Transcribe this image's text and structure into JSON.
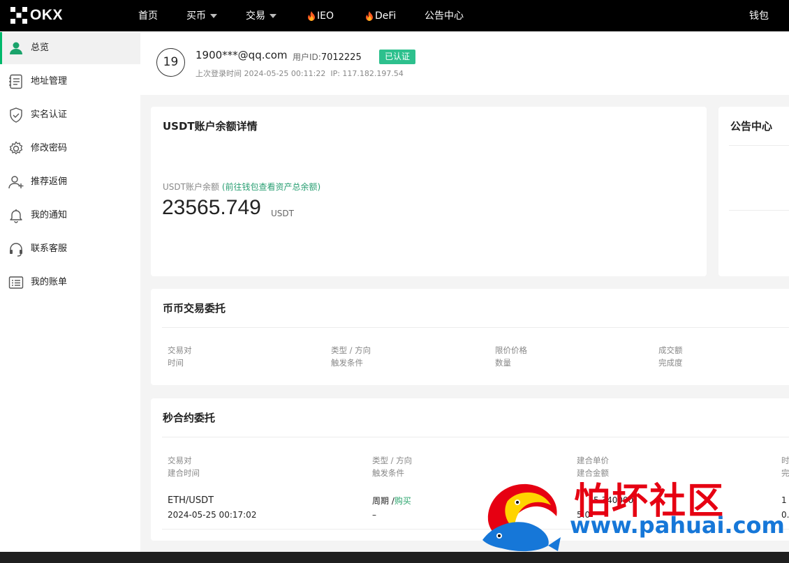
{
  "topbar": {
    "brand": "OKX",
    "nav": [
      {
        "label": "首页"
      },
      {
        "label": "买币"
      },
      {
        "label": "交易"
      },
      {
        "label": "IEO"
      },
      {
        "label": "DeFi"
      },
      {
        "label": "公告中心"
      }
    ],
    "wallet": "钱包"
  },
  "sidebar": {
    "items": [
      {
        "label": "总览",
        "icon": "user-icon"
      },
      {
        "label": "地址管理",
        "icon": "address-list-icon"
      },
      {
        "label": "实名认证",
        "icon": "shield-check-icon"
      },
      {
        "label": "修改密码",
        "icon": "gear-icon"
      },
      {
        "label": "推荐返佣",
        "icon": "user-add-icon"
      },
      {
        "label": "我的通知",
        "icon": "bell-icon"
      },
      {
        "label": "联系客服",
        "icon": "headset-icon"
      },
      {
        "label": "我的账单",
        "icon": "list-icon"
      }
    ]
  },
  "profile": {
    "avatar": "19",
    "email": "1900***@qq.com",
    "uid_label": "用户ID:",
    "uid_value": "7012225",
    "verified": "已认证",
    "last_login": "上次登录时间 2024-05-25 00:11:22",
    "ip": "IP: 117.182.197.54"
  },
  "balance": {
    "title": "USDT账户余额详情",
    "label": "USDT账户余额",
    "link": "(前往钱包查看资产总余额)",
    "value": "23565.749",
    "unit": "USDT"
  },
  "notice": {
    "title": "公告中心"
  },
  "spot": {
    "title": "币币交易委托",
    "headers": [
      [
        "交易对",
        "时间"
      ],
      [
        "类型 / 方向",
        "触发条件"
      ],
      [
        "限价价格",
        "数量"
      ],
      [
        "成交额",
        "完成度"
      ]
    ]
  },
  "contract": {
    "title": "秒合约委托",
    "headers": [
      [
        "交易对",
        "建合时间"
      ],
      [
        "类型 / 方向",
        "触发条件"
      ],
      [
        "建合单价",
        "建合金额"
      ],
      [
        "时",
        "完"
      ]
    ],
    "rows": [
      {
        "pair": "ETH/USDT",
        "time": "2024-05-25 00:17:02",
        "type": "周期 /",
        "direction": "购买",
        "trigger": "–",
        "price": "5.340000",
        "amount": "5.0",
        "col4a": "1",
        "col4b": "0."
      }
    ]
  },
  "watermark": {
    "title": "怕坏社区",
    "url": "www.pahuai.com"
  }
}
